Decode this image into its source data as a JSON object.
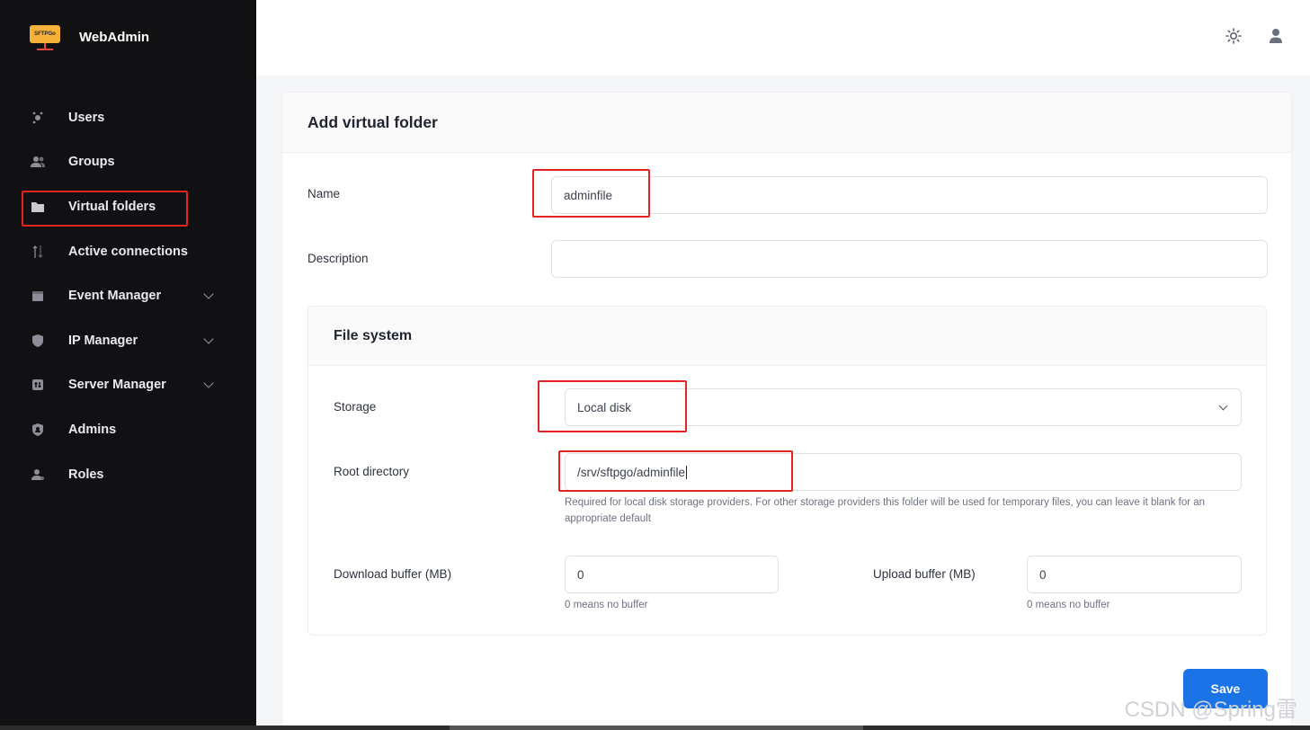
{
  "brand": {
    "name": "WebAdmin",
    "logo_text": "SFTPGo"
  },
  "sidebar": {
    "items": [
      {
        "label": "Users",
        "icon": "users-icon"
      },
      {
        "label": "Groups",
        "icon": "groups-icon"
      },
      {
        "label": "Virtual folders",
        "icon": "folder-icon"
      },
      {
        "label": "Active connections",
        "icon": "connections-icon"
      },
      {
        "label": "Event Manager",
        "icon": "calendar-icon"
      },
      {
        "label": "IP Manager",
        "icon": "shield-icon"
      },
      {
        "label": "Server Manager",
        "icon": "server-icon"
      },
      {
        "label": "Admins",
        "icon": "admin-icon"
      },
      {
        "label": "Roles",
        "icon": "role-icon"
      }
    ]
  },
  "form": {
    "title": "Add virtual folder",
    "name_label": "Name",
    "name_value": "adminfile",
    "description_label": "Description",
    "description_value": "",
    "fs": {
      "title": "File system",
      "storage_label": "Storage",
      "storage_value": "Local disk",
      "root_label": "Root directory",
      "root_value": "/srv/sftpgo/adminfile",
      "root_hint": "Required for local disk storage providers. For other storage providers this folder will be used for temporary files, you can leave it blank for an appropriate default",
      "download_label": "Download buffer (MB)",
      "download_value": "0",
      "download_hint": "0 means no buffer",
      "upload_label": "Upload buffer (MB)",
      "upload_value": "0",
      "upload_hint": "0 means no buffer"
    },
    "save_label": "Save"
  },
  "watermark": "CSDN @Spring雷"
}
